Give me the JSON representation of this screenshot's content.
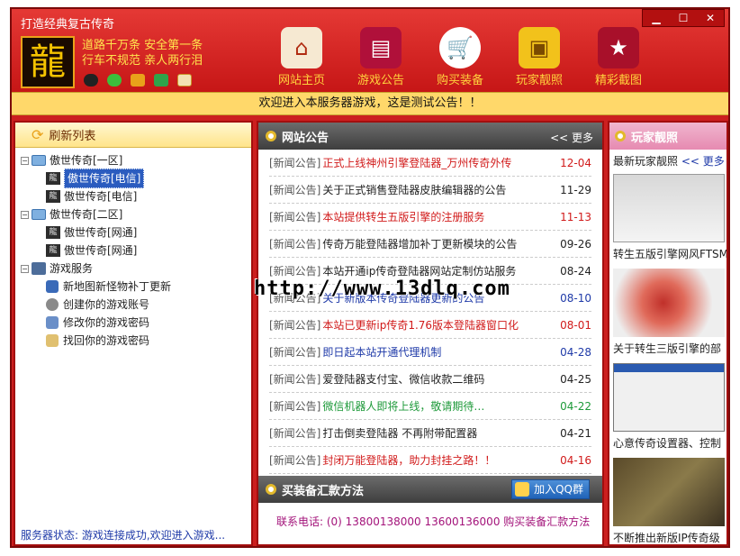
{
  "app_title": "打造经典复古传奇",
  "window_controls": {
    "minimize": "▁",
    "maximize": "☐",
    "close": "✕"
  },
  "logo_text": "龍",
  "slogan": {
    "line1": "道路千万条 安全第一条",
    "line2": "行车不规范 亲人两行泪"
  },
  "nav": [
    {
      "label": "网站主页",
      "icon": "house-icon"
    },
    {
      "label": "游戏公告",
      "icon": "notice-icon"
    },
    {
      "label": "购买装备",
      "icon": "cart-icon"
    },
    {
      "label": "玩家靓照",
      "icon": "photo-folder-icon"
    },
    {
      "label": "精彩截图",
      "icon": "star-icon"
    }
  ],
  "notice": "欢迎进入本服务器游戏，这是测试公告！！",
  "server_list": {
    "header": "刷新列表",
    "groups": [
      {
        "name": "傲世传奇[一区]",
        "servers": [
          "傲世传奇[电信]",
          "傲世传奇[电信]"
        ]
      },
      {
        "name": "傲世传奇[二区]",
        "servers": [
          "傲世传奇[网通]",
          "傲世传奇[网通]"
        ]
      }
    ],
    "services_group": "游戏服务",
    "services": [
      "新地图新怪物补丁更新",
      "创建你的游戏账号",
      "修改你的游戏密码",
      "找回你的游戏密码"
    ],
    "status": "服务器状态: 游戏连接成功,欢迎进入游戏..."
  },
  "news": {
    "header": "网站公告",
    "more": "<< 更多",
    "items": [
      {
        "tag": "[新闻公告]",
        "title": "正式上线神州引擎登陆器_万州传奇外传",
        "date": "12-04",
        "color": "#d11a1a"
      },
      {
        "tag": "[新闻公告]",
        "title": "关于正式销售登陆器皮肤编辑器的公告",
        "date": "11-29",
        "color": "#222222"
      },
      {
        "tag": "[新闻公告]",
        "title": "本站提供转生五版引擎的注册服务",
        "date": "11-13",
        "color": "#d11a1a"
      },
      {
        "tag": "[新闻公告]",
        "title": "传奇万能登陆器增加补丁更新模块的公告",
        "date": "09-26",
        "color": "#222222"
      },
      {
        "tag": "[新闻公告]",
        "title": "本站开通ip传奇登陆器网站定制仿站服务",
        "date": "08-24",
        "color": "#222222"
      },
      {
        "tag": "[新闻公告]",
        "title": "关于新版本传奇登陆器更新的公告",
        "date": "08-10",
        "color": "#1f3aa8"
      },
      {
        "tag": "[新闻公告]",
        "title": "本站已更新ip传奇1.76版本登陆器窗口化",
        "date": "08-01",
        "color": "#d11a1a"
      },
      {
        "tag": "[新闻公告]",
        "title": "即日起本站开通代理机制",
        "date": "04-28",
        "color": "#1f3aa8"
      },
      {
        "tag": "[新闻公告]",
        "title": "爱登陆器支付宝、微信收款二维码",
        "date": "04-25",
        "color": "#222222"
      },
      {
        "tag": "[新闻公告]",
        "title": "微信机器人即将上线，敬请期待…",
        "date": "04-22",
        "color": "#1e9a3a"
      },
      {
        "tag": "[新闻公告]",
        "title": "打击倒卖登陆器 不再附带配置器",
        "date": "04-21",
        "color": "#222222"
      },
      {
        "tag": "[新闻公告]",
        "title": "封闭万能登陆器，助力封挂之路！！",
        "date": "04-16",
        "color": "#d11a1a"
      }
    ]
  },
  "payment": {
    "header": "买装备汇款方法",
    "qq_button": "加入QQ群",
    "contact": "联系电话: (0) 13800138000 13600136000 购买装备汇款方法"
  },
  "photos": {
    "header": "玩家靓照",
    "subtitle": "最新玩家靓照",
    "more": "<< 更多",
    "items": [
      {
        "caption": "转生五版引擎网风FTSM"
      },
      {
        "caption": "关于转生三版引擎的部"
      },
      {
        "caption": "心意传奇设置器、控制"
      },
      {
        "caption": "不断推出新版IP传奇级"
      }
    ]
  },
  "watermark": "http://www.13dlq.com"
}
